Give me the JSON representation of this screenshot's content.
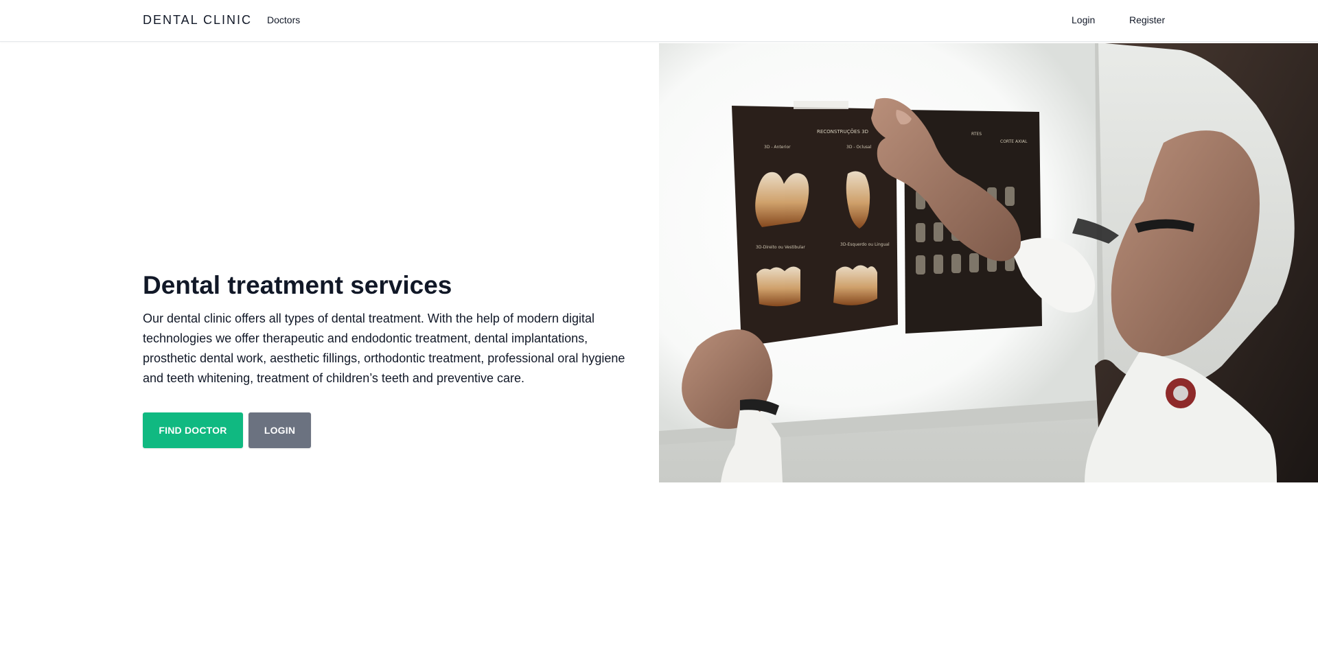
{
  "nav": {
    "brand": "DENTAL CLINIC",
    "links": [
      "Doctors"
    ],
    "auth": {
      "login": "Login",
      "register": "Register"
    }
  },
  "hero": {
    "title": "Dental treatment services",
    "description": "Our dental clinic offers all types of dental treatment. With the help of modern digital technologies we offer therapeutic and endodontic treatment, dental implantations, prosthetic dental work, aesthetic fillings, orthodontic treatment, professional oral hygiene and teeth whitening, treatment of children’s teeth and preventive care.",
    "buttons": {
      "primary": "FIND DOCTOR",
      "secondary": "LOGIN"
    },
    "image": {
      "sheet_left": {
        "title": "RECONSTRUÇÕES 3D",
        "labels": [
          "3D - Anterior",
          "3D - Oclusal",
          "3D-Direito ou Vestibular",
          "3D-Esquerdo ou Lingual"
        ]
      },
      "sheet_right": {
        "labels": [
          "RTES",
          "CORTE AXIAL"
        ]
      }
    }
  },
  "colors": {
    "primary": "#10b981",
    "secondary": "#6b7280",
    "text": "#111827",
    "border": "#e5e7eb"
  }
}
